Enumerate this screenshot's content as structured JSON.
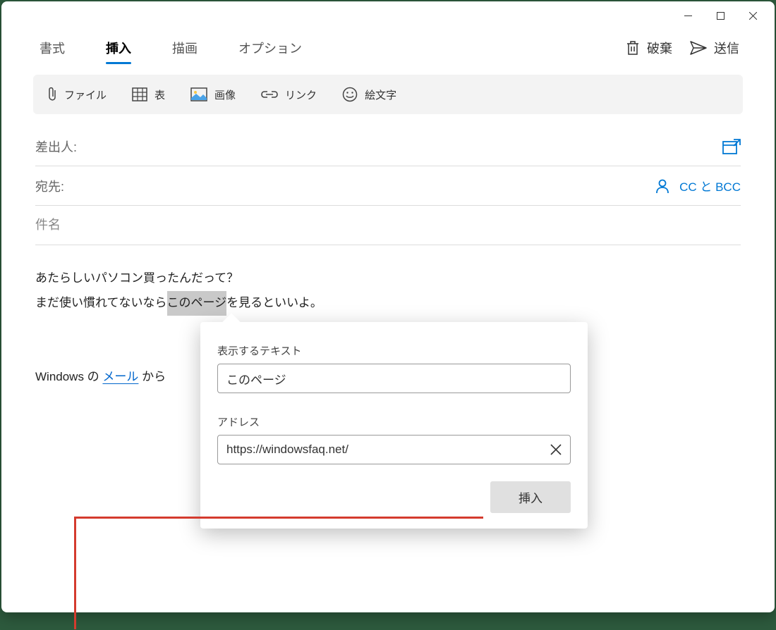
{
  "titlebar": {},
  "tabs": {
    "format": "書式",
    "insert": "挿入",
    "draw": "描画",
    "options": "オプション"
  },
  "actions": {
    "discard": "破棄",
    "send": "送信"
  },
  "toolbar": {
    "file": "ファイル",
    "table": "表",
    "image": "画像",
    "link": "リンク",
    "emoji": "絵文字"
  },
  "fields": {
    "from_label": "差出人:",
    "to_label": "宛先:",
    "ccbcc": "CC と BCC",
    "subject_placeholder": "件名"
  },
  "body": {
    "line1": "あたらしいパソコン買ったんだって？",
    "line2_before": "まだ使い慣れてないなら",
    "line2_highlight": "このページ",
    "line2_after": "を見るといいよ。",
    "sig_before": "Windows の ",
    "sig_link": "メール",
    "sig_after": " から"
  },
  "popover": {
    "text_label": "表示するテキスト",
    "text_value": "このページ",
    "addr_label": "アドレス",
    "addr_value": "https://windowsfaq.net/",
    "insert": "挿入"
  }
}
